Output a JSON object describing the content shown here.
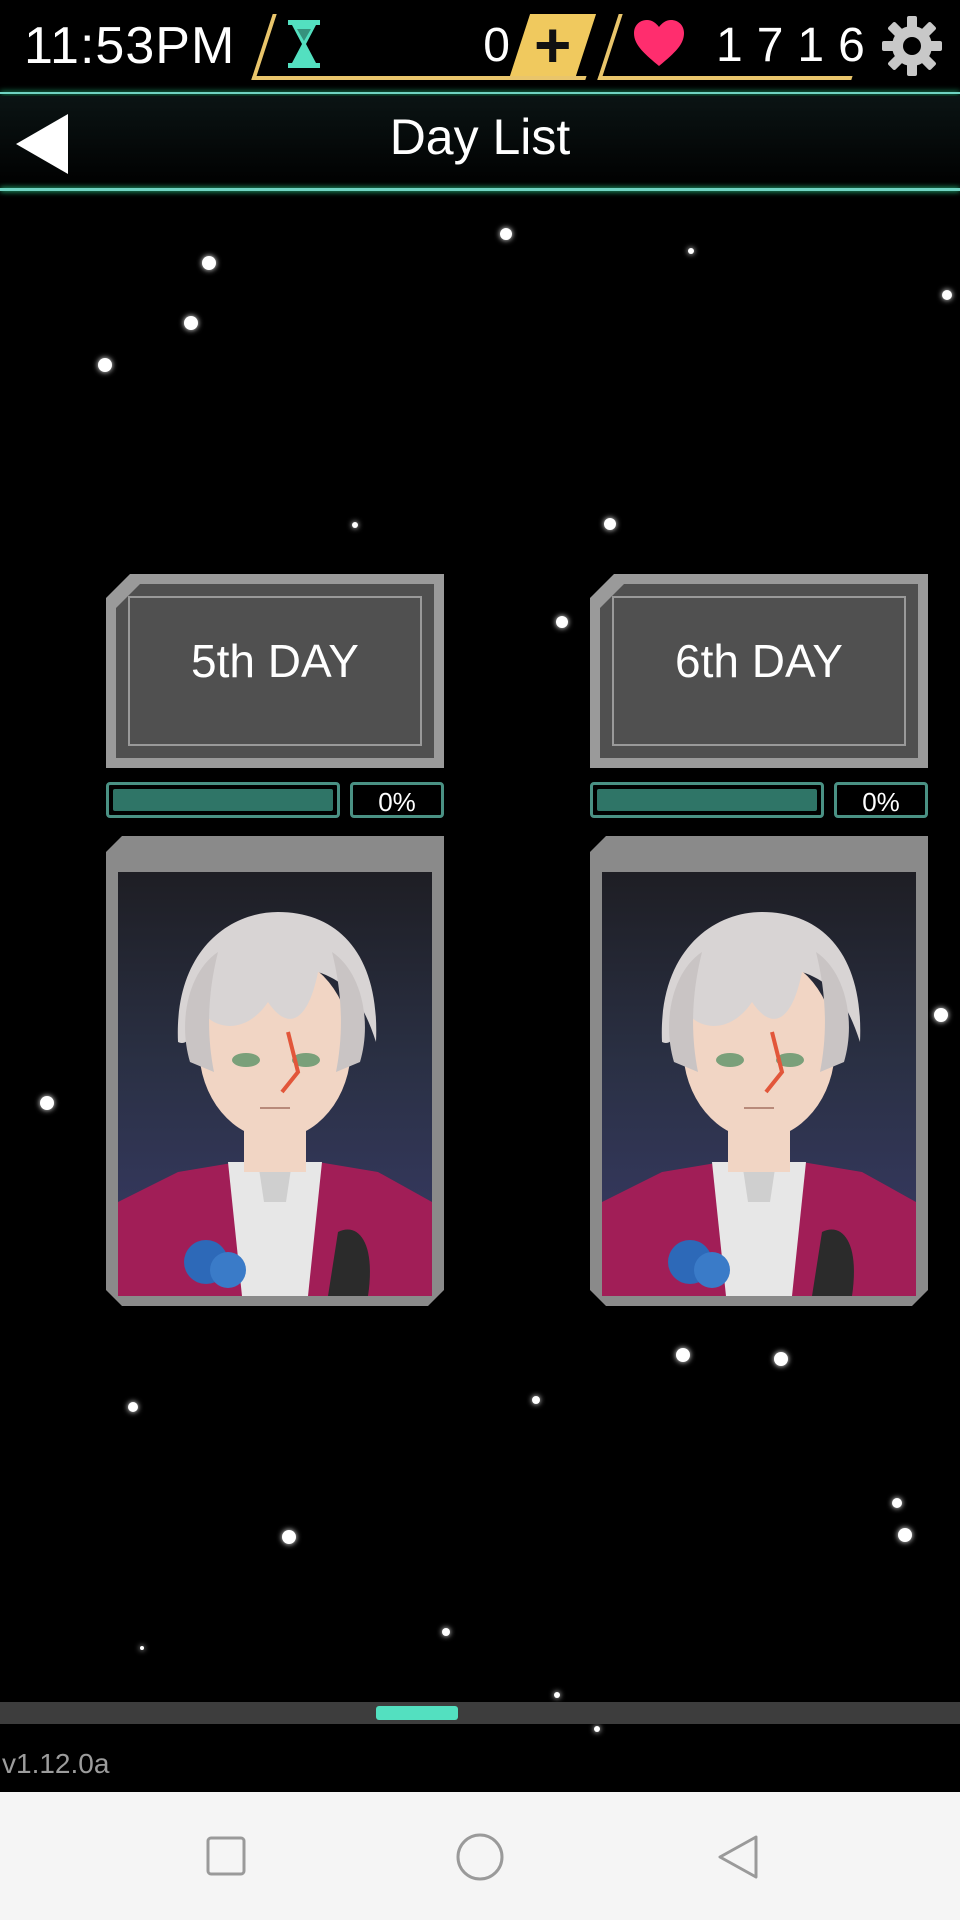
{
  "status": {
    "time": "11:53PM",
    "hourglass_count": "0",
    "plus_label": "+",
    "heart_count": "1716"
  },
  "header": {
    "title": "Day List"
  },
  "days": [
    {
      "label": "5th DAY",
      "progress_text": "0%",
      "progress": 0
    },
    {
      "label": "6th DAY",
      "progress_text": "0%",
      "progress": 0
    }
  ],
  "footer": {
    "version": "v1.12.0a"
  },
  "colors": {
    "accent": "#53e0c0",
    "gold": "#e9c56b",
    "heart": "#ff2d6e"
  },
  "icons": {
    "hourglass": "hourglass-icon",
    "heart": "heart-icon",
    "settings": "gear-icon",
    "back": "back-arrow-icon"
  }
}
